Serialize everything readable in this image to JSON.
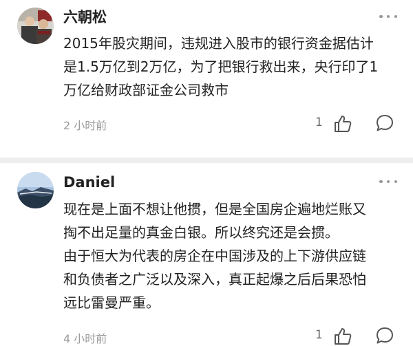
{
  "comments": [
    {
      "author": "六朝松",
      "lines": [
        "2015年股灾期间，违规进入股市的银行资金据估计",
        "是1.5万亿到2万亿，为了把银行救出来，央行印了1",
        "万亿给财政部证金公司救市"
      ],
      "time": "2 小时前",
      "likes": "1"
    },
    {
      "author": "Daniel",
      "lines": [
        "现在是上面不想让他掼，但是全国房企遍地烂账又",
        "掏不出足量的真金白银。所以终究还是会掼。",
        "由于恒大为代表的房企在中国涉及的上下游供应链",
        "和负债者之广泛以及深入，真正起爆之后后果恐怕",
        "远比雷曼严重。"
      ],
      "time": "4 小时前",
      "likes": "1"
    }
  ],
  "icons": {
    "more": "more-dots-icon",
    "like": "thumbs-up-icon",
    "reply": "comment-bubble-icon"
  },
  "colors": {
    "text": "#222222",
    "meta": "#9a9a9a",
    "icon": "#555555",
    "divider": "#eeeeee"
  }
}
